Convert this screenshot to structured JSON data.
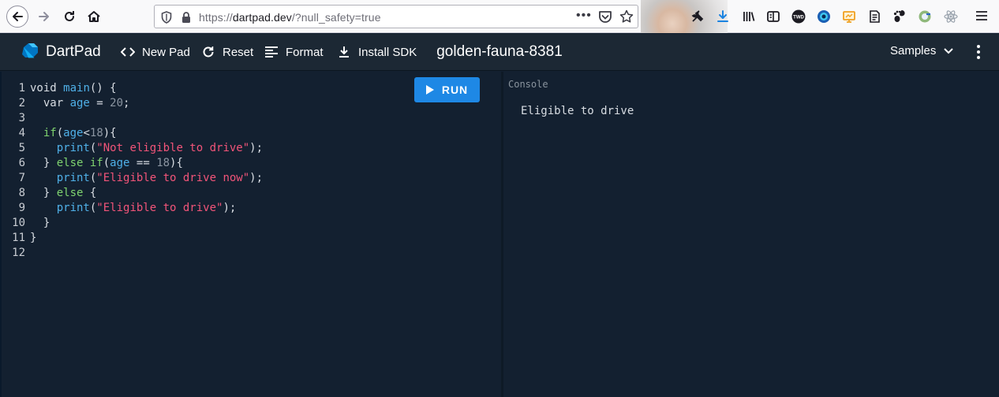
{
  "browser": {
    "url_prefix": "https://",
    "url_host": "dartpad.dev",
    "url_rest": "/?null_safety=true",
    "more_label": "•••",
    "extensions": [
      "wrench-icon",
      "download-icon",
      "library-icon",
      "reader-icon",
      "twd-icon",
      "globe-icon",
      "screen-icon",
      "notes-icon",
      "gnome-icon",
      "puzzle-icon",
      "react-icon"
    ]
  },
  "header": {
    "app_title": "DartPad",
    "new_pad": "New Pad",
    "reset": "Reset",
    "format": "Format",
    "install_sdk": "Install SDK",
    "pad_name": "golden-fauna-8381",
    "samples": "Samples"
  },
  "editor": {
    "run_label": "RUN",
    "lines": [
      [
        {
          "t": "void ",
          "c": "plain"
        },
        {
          "t": "main",
          "c": "fn"
        },
        {
          "t": "() {",
          "c": "plain"
        }
      ],
      [
        {
          "t": "  var ",
          "c": "plain"
        },
        {
          "t": "age",
          "c": "var"
        },
        {
          "t": " = ",
          "c": "plain"
        },
        {
          "t": "20",
          "c": "num"
        },
        {
          "t": ";",
          "c": "plain"
        }
      ],
      [],
      [
        {
          "t": "  if",
          "c": "kw"
        },
        {
          "t": "(",
          "c": "plain"
        },
        {
          "t": "age",
          "c": "var"
        },
        {
          "t": "<",
          "c": "plain"
        },
        {
          "t": "18",
          "c": "num"
        },
        {
          "t": "){",
          "c": "plain"
        }
      ],
      [
        {
          "t": "    print",
          "c": "fn"
        },
        {
          "t": "(",
          "c": "plain"
        },
        {
          "t": "\"Not eligible to drive\"",
          "c": "str"
        },
        {
          "t": ");",
          "c": "plain"
        }
      ],
      [
        {
          "t": "  } ",
          "c": "plain"
        },
        {
          "t": "else if",
          "c": "kw"
        },
        {
          "t": "(",
          "c": "plain"
        },
        {
          "t": "age",
          "c": "var"
        },
        {
          "t": " == ",
          "c": "plain"
        },
        {
          "t": "18",
          "c": "num"
        },
        {
          "t": "){",
          "c": "plain"
        }
      ],
      [
        {
          "t": "    print",
          "c": "fn"
        },
        {
          "t": "(",
          "c": "plain"
        },
        {
          "t": "\"Eligible to drive now\"",
          "c": "str"
        },
        {
          "t": ");",
          "c": "plain"
        }
      ],
      [
        {
          "t": "  } ",
          "c": "plain"
        },
        {
          "t": "else",
          "c": "kw"
        },
        {
          "t": " {",
          "c": "plain"
        }
      ],
      [
        {
          "t": "    print",
          "c": "fn"
        },
        {
          "t": "(",
          "c": "plain"
        },
        {
          "t": "\"Eligible to drive\"",
          "c": "str"
        },
        {
          "t": ");",
          "c": "plain"
        }
      ],
      [
        {
          "t": "  }",
          "c": "plain"
        }
      ],
      [
        {
          "t": "}",
          "c": "plain"
        }
      ],
      []
    ]
  },
  "console": {
    "label": "Console",
    "output": "Eligible to drive"
  },
  "colors": {
    "fn": "#4fb0e8",
    "var": "#4fb0e8",
    "kw": "#7fd36f",
    "str": "#f25479",
    "num": "#8b95a1",
    "plain": "#d8dde3",
    "run": "#1e88e5"
  }
}
